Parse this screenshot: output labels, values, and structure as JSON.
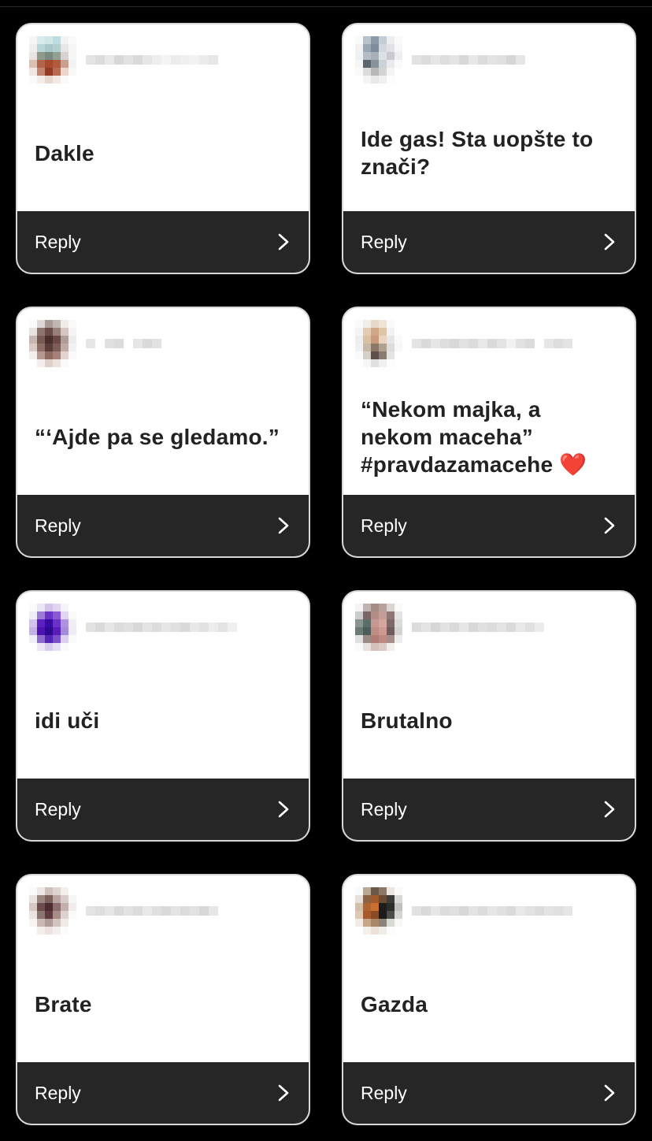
{
  "cards": [
    {
      "comment": "Dakle",
      "reply_label": "Reply",
      "avatar_colors": [
        "#f5f5f5",
        "#d8ecee",
        "#cfe6e8",
        "#bcdcde",
        "#f2f2f2",
        "#fafafa",
        "#eeeeee",
        "#b9d6d6",
        "#a8c9c8",
        "#b4cfcd",
        "#e6e6e6",
        "#f6f6f6",
        "#e9e4e2",
        "#8f9a8c",
        "#7a8a80",
        "#94a093",
        "#d8d3d0",
        "#f7f7f7",
        "#dcc0b4",
        "#b4644d",
        "#a84a30",
        "#b05a40",
        "#c8a090",
        "#f3f3f3",
        "#f0e6e2",
        "#c48470",
        "#943a22",
        "#b86a50",
        "#ead8d0",
        "#f8f8f8",
        "#fafafa",
        "#f4ece8",
        "#e8d8d0",
        "#f2e8e4",
        "#fafafa",
        "#ffffff"
      ],
      "username_colors": [
        "#e4e4e4",
        "#dcdcdc",
        "#e8e8e8",
        "#d8d8d8",
        "#e2e2e2",
        "#dadada",
        "#e6e6e6",
        "#eeeeee",
        "#f4f4f4",
        "#ececec",
        "#f0f0f0",
        "#f2f2f2",
        "#ececec",
        "#e6e6e6"
      ]
    },
    {
      "comment": "Ide gas! Sta uopšte to znači?",
      "reply_label": "Reply",
      "avatar_colors": [
        "#fafafa",
        "#b8c2cc",
        "#8c9aa8",
        "#c4ccd4",
        "#eceef0",
        "#fafafa",
        "#f2f2f2",
        "#9aa8b6",
        "#7c8c9c",
        "#d2d8de",
        "#e0e2e6",
        "#f6f6f6",
        "#eef0f2",
        "#b4bcc4",
        "#a8b0b8",
        "#dee2e6",
        "#c8ccd0",
        "#eeeeee",
        "#f6f6f6",
        "#5c6670",
        "#8a929a",
        "#cdd2d6",
        "#e8eaec",
        "#fafafa",
        "#fafafa",
        "#dcdcdc",
        "#b8b8b8",
        "#d4d4d4",
        "#f4f4f4",
        "#ffffff",
        "#ffffff",
        "#f4f4f4",
        "#e8e8e8",
        "#f0f0f0",
        "#fcfcfc",
        "#ffffff"
      ],
      "username_colors": [
        "#e2e2e2",
        "#dcdcdc",
        "#e6e6e6",
        "#dedede",
        "#e4e4e4",
        "#d8d8d8",
        "#e8e8e8",
        "#dcdcdc",
        "#e4e4e4",
        "#e0e0e0",
        "#d6d6d6",
        "#e6e6e6"
      ]
    },
    {
      "comment": "“‘Ajde pa se gledamo.”",
      "reply_label": "Reply",
      "avatar_colors": [
        "#fafafa",
        "#e0d8d6",
        "#a89a96",
        "#c2b6b2",
        "#f0ecea",
        "#fafafa",
        "#e8e2e0",
        "#8c7470",
        "#6c4c48",
        "#9a807a",
        "#d4c6c2",
        "#f4f4f4",
        "#c8b6b2",
        "#7a5a54",
        "#4a2e2c",
        "#6a4a46",
        "#b09c98",
        "#ececec",
        "#dccac4",
        "#8c6e66",
        "#5a3c38",
        "#7c5c56",
        "#c0aaa4",
        "#f2f2f2",
        "#f4eeec",
        "#b49890",
        "#906a60",
        "#a48078",
        "#e2d4d0",
        "#fafafa",
        "#ffffff",
        "#f4eeec",
        "#e0d0cc",
        "#ece2de",
        "#fafafa",
        "#ffffff"
      ],
      "username_colors": [
        "#e6e6e6",
        "#ffffff",
        "#e0e0e0",
        "#dcdcdc",
        "#ffffff",
        "#e6e6e6",
        "#dadada",
        "#e2e2e2"
      ]
    },
    {
      "comment": "“Nekom majka, a nekom maceha” #pravdazamacehe ❤️",
      "reply_label": "Reply",
      "avatar_colors": [
        "#fafafa",
        "#f2ece6",
        "#e8d8c8",
        "#f0e4d8",
        "#fafafa",
        "#ffffff",
        "#f4f4f4",
        "#e4ccb4",
        "#d0a888",
        "#e0c4a8",
        "#f2f2f2",
        "#ffffff",
        "#eeeeee",
        "#dcc0a4",
        "#c89c7c",
        "#e8d4c0",
        "#e6e6e6",
        "#fafafa",
        "#f0f0f0",
        "#c8b8a8",
        "#8c7868",
        "#b0a090",
        "#dcdcdc",
        "#f8f8f8",
        "#fafafa",
        "#d8d0c8",
        "#5c5048",
        "#8a7c70",
        "#e4e4e4",
        "#ffffff",
        "#ffffff",
        "#f6f6f6",
        "#e0e0e0",
        "#f0f0f0",
        "#fcfcfc",
        "#ffffff"
      ],
      "username_colors": [
        "#e4e4e4",
        "#dadada",
        "#e6e6e6",
        "#dedede",
        "#d8d8d8",
        "#e2e2e2",
        "#dcdcdc",
        "#e8e8e8",
        "#dadada",
        "#e4e4e4",
        "#f2f2f2",
        "#e2e2e2",
        "#dcdcdc",
        "#ffffff",
        "#e6e6e6",
        "#dedede",
        "#e4e4e4"
      ]
    },
    {
      "comment": "idi uči",
      "reply_label": "Reply",
      "avatar_colors": [
        "#fafafa",
        "#eae4f4",
        "#d4c4ec",
        "#e0d4f0",
        "#f6f4fa",
        "#ffffff",
        "#f0ecf8",
        "#9c7ad8",
        "#6a34c8",
        "#8a5ad4",
        "#e0d6f2",
        "#fafafa",
        "#d2c2ec",
        "#5a20c0",
        "#3a0aa4",
        "#6a32c6",
        "#ae94e0",
        "#f2eef8",
        "#c4b0e6",
        "#4c12b4",
        "#2e0890",
        "#5a1cb8",
        "#a48ada",
        "#eeeaf6",
        "#f0ecf8",
        "#8e6ad0",
        "#5424b8",
        "#7a50c8",
        "#dcd0f0",
        "#fafafa",
        "#ffffff",
        "#ece6f6",
        "#d8ccee",
        "#e6e0f4",
        "#fafafa",
        "#ffffff"
      ],
      "username_colors": [
        "#e2e2e2",
        "#dadada",
        "#e6e6e6",
        "#dcdcdc",
        "#e0e0e0",
        "#d8d8d8",
        "#e4e4e4",
        "#dcdcdc",
        "#e6e6e6",
        "#e0e0e0",
        "#dadada",
        "#e8e8e8",
        "#e2e2e2",
        "#ececec",
        "#e4e4e4",
        "#f0f0f0"
      ]
    },
    {
      "comment": "Brutalno",
      "reply_label": "Reply",
      "avatar_colors": [
        "#f4f4f4",
        "#c0b4b0",
        "#a48c88",
        "#b8a09c",
        "#dcd4d2",
        "#fafafa",
        "#cccccc",
        "#7a6664",
        "#b48c88",
        "#c49c98",
        "#8c7874",
        "#e4e4e4",
        "#8a9490",
        "#5c6e6a",
        "#c89890",
        "#d4a8a0",
        "#7c6a66",
        "#dadada",
        "#6c7a76",
        "#4c5c58",
        "#c08c84",
        "#cc9c94",
        "#6e5c58",
        "#d2d2d2",
        "#e0e0e0",
        "#9a8a86",
        "#b07c74",
        "#bc8a82",
        "#a48e8a",
        "#ececec",
        "#fafafa",
        "#e8e0de",
        "#d4c0bc",
        "#dccac6",
        "#f2eeec",
        "#ffffff"
      ],
      "username_colors": [
        "#dcdcdc",
        "#e4e4e4",
        "#d6d6d6",
        "#e2e2e2",
        "#dadada",
        "#e6e6e6",
        "#d8d8d8",
        "#e0e0e0",
        "#dcdcdc",
        "#e4e4e4",
        "#dadada",
        "#e8e8e8",
        "#e0e0e0",
        "#ececec"
      ]
    },
    {
      "comment": "Brate",
      "reply_label": "Reply",
      "avatar_colors": [
        "#fafafa",
        "#ece6e4",
        "#d0c0bc",
        "#e0d4d0",
        "#f4f0ee",
        "#ffffff",
        "#eae2e0",
        "#9c8480",
        "#7c605c",
        "#b8a4a0",
        "#d8ccc8",
        "#f6f6f6",
        "#d8c8c4",
        "#6c4c4c",
        "#4c2c30",
        "#8c6c6c",
        "#c4b0ac",
        "#f0eeec",
        "#ece4e2",
        "#8c7470",
        "#603c40",
        "#a88c88",
        "#dcd2ce",
        "#fafafa",
        "#f8f4f2",
        "#cab8b4",
        "#b09c98",
        "#d4c4c0",
        "#f0eae8",
        "#ffffff",
        "#ffffff",
        "#f4eeec",
        "#ece2e0",
        "#f4eeec",
        "#fcfcfc",
        "#ffffff"
      ],
      "username_colors": [
        "#e4e4e4",
        "#dedede",
        "#e6e6e6",
        "#dadada",
        "#e2e2e2",
        "#dcdcdc",
        "#e8e8e8",
        "#e0e0e0",
        "#dadada",
        "#e4e4e4",
        "#dcdcdc",
        "#e2e2e2",
        "#d8d8d8",
        "#e6e6e6"
      ]
    },
    {
      "comment": "Gazda",
      "reply_label": "Reply",
      "avatar_colors": [
        "#fafafa",
        "#b8a894",
        "#6c5848",
        "#8c7868",
        "#ece6e0",
        "#fafafa",
        "#e8e0d8",
        "#8c6444",
        "#a05a2c",
        "#6c4c34",
        "#3c3c38",
        "#d8d8d4",
        "#d4c0a8",
        "#b06430",
        "#c8702c",
        "#1c1c1a",
        "#2c2c28",
        "#c0c0bc",
        "#e0c8b0",
        "#a8582a",
        "#8a4a24",
        "#1a1a18",
        "#4c4c48",
        "#d4d4d0",
        "#f4ece4",
        "#c8a488",
        "#a88868",
        "#8c8478",
        "#d8d8d4",
        "#f8f8f8",
        "#ffffff",
        "#f6f0ea",
        "#ece2d8",
        "#f0ece8",
        "#fcfcfc",
        "#ffffff"
      ],
      "username_colors": [
        "#e2e2e2",
        "#dadada",
        "#e6e6e6",
        "#dcdcdc",
        "#e0e0e0",
        "#d8d8d8",
        "#e4e4e4",
        "#dcdcdc",
        "#e6e6e6",
        "#e0e0e0",
        "#dadada",
        "#e8e8e8",
        "#e2e2e2",
        "#dcdcdc",
        "#e4e4e4",
        "#e0e0e0",
        "#e6e6e6"
      ]
    }
  ],
  "colors": {
    "page_background": "#000000",
    "card_background": "#ffffff",
    "reply_bar": "#262626",
    "reply_text": "#ffffff",
    "comment_text": "#222222"
  },
  "icons": {
    "reply_chevron": "chevron-right-icon"
  }
}
